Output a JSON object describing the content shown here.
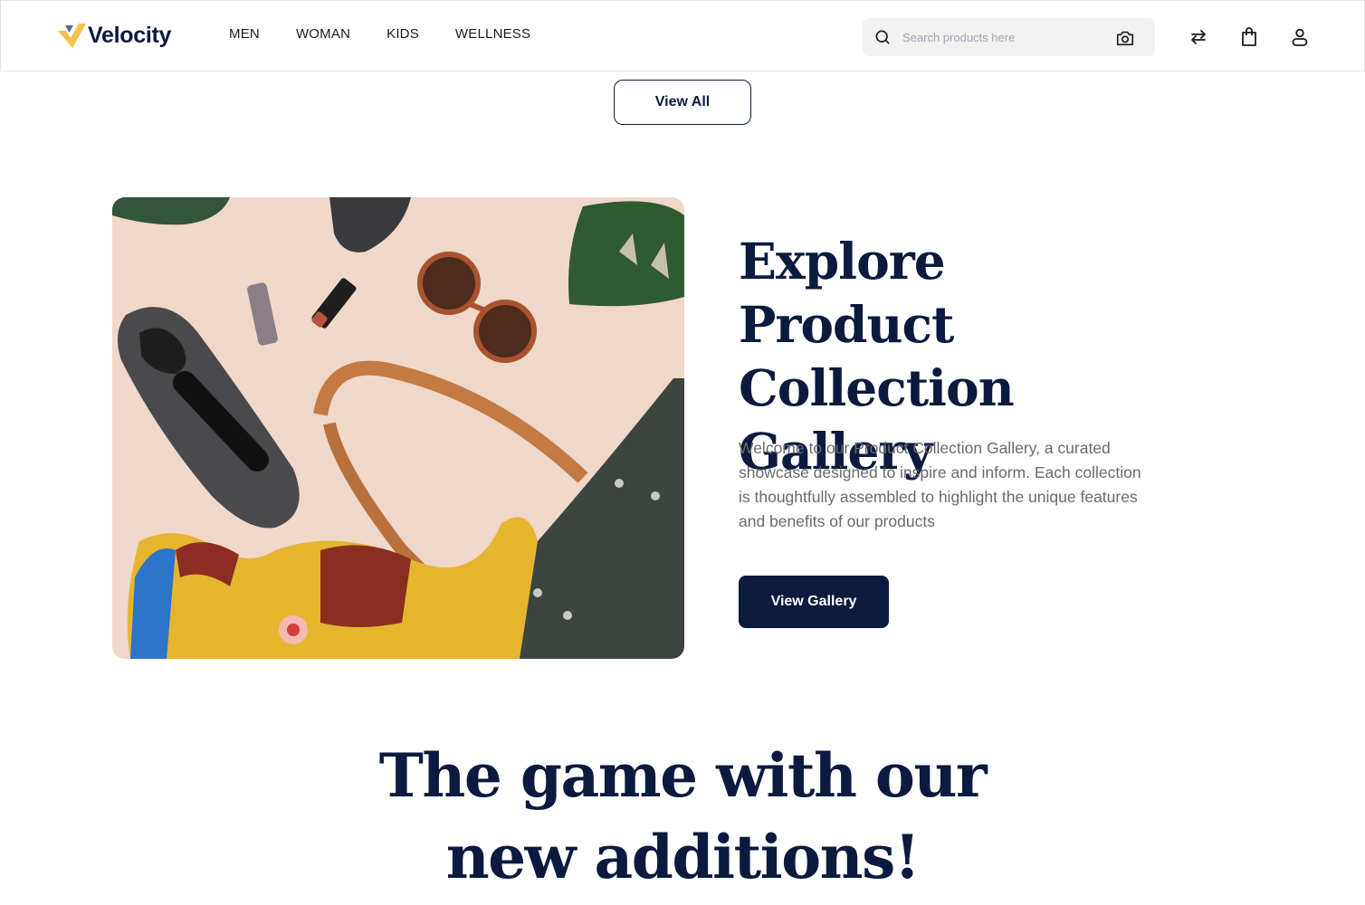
{
  "header": {
    "brand": "Velocity",
    "brand_colors": {
      "primary": "#0c1a3f",
      "accent": "#f7c04a",
      "accent_secondary": "#4a6fa5"
    },
    "nav": [
      {
        "label": "MEN"
      },
      {
        "label": "WOMAN"
      },
      {
        "label": "KIDS"
      },
      {
        "label": "WELLNESS"
      }
    ],
    "search": {
      "placeholder": "Search products here",
      "value": "",
      "icon": "search-icon",
      "image_search_icon": "camera-icon"
    },
    "actions": [
      {
        "icon": "compare-arrows-icon",
        "label": "Compare"
      },
      {
        "icon": "shopping-bag-icon",
        "label": "Cart"
      },
      {
        "icon": "user-icon",
        "label": "Account"
      }
    ]
  },
  "view_all": {
    "label": "View All"
  },
  "gallery": {
    "image_alt": "Flat lay of sneakers, lipsticks, sunglasses, leather tote bag, scarf and monstera leaves",
    "title": "Explore Product Collection Gallery",
    "description": "Welcome to our Product Collection Gallery, a curated showcase designed to inspire and inform. Each collection is thoughtfully assembled to highlight the unique features and benefits of our products",
    "cta_label": "View Gallery",
    "cta_color": "#0c1a3f"
  },
  "additions": {
    "title_line1": "The game with our",
    "title_line2": "new additions!"
  }
}
